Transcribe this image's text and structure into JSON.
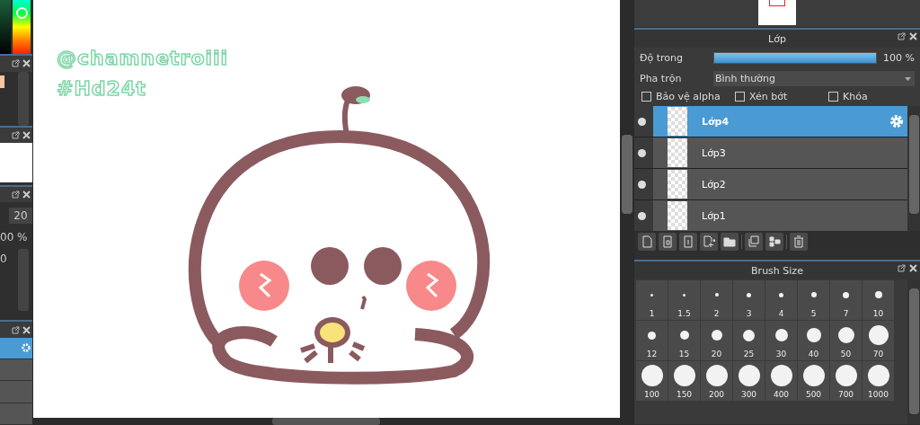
{
  "left_strip": {
    "size_value": "20",
    "opacity_value": "00 %",
    "slider_value": "0"
  },
  "canvas": {
    "signature": [
      "@chamnetroiii",
      "#Hd24t"
    ]
  },
  "layer_panel": {
    "title": "Lớp",
    "opacity_label": "Độ trong",
    "opacity": {
      "level": 1,
      "reading": "100 %"
    },
    "blend_label": "Pha trộn",
    "blend_value": "Bình thường",
    "options": [
      {
        "label": "Bảo vệ alpha",
        "checked": false
      },
      {
        "label": "Xén bớt",
        "checked": false
      },
      {
        "label": "Khóa",
        "checked": false
      }
    ],
    "layers": [
      {
        "name": "Lớp4",
        "selected": true
      },
      {
        "name": "Lớp3",
        "selected": false
      },
      {
        "name": "Lớp2",
        "selected": false
      },
      {
        "name": "Lớp1",
        "selected": false
      }
    ]
  },
  "brush_panel": {
    "title": "Brush Size",
    "sizes": [
      "1",
      "1.5",
      "2",
      "3",
      "4",
      "5",
      "7",
      "10",
      "12",
      "15",
      "20",
      "25",
      "30",
      "40",
      "50",
      "70",
      "100",
      "150",
      "200",
      "300",
      "400",
      "500",
      "700",
      "1000"
    ]
  }
}
